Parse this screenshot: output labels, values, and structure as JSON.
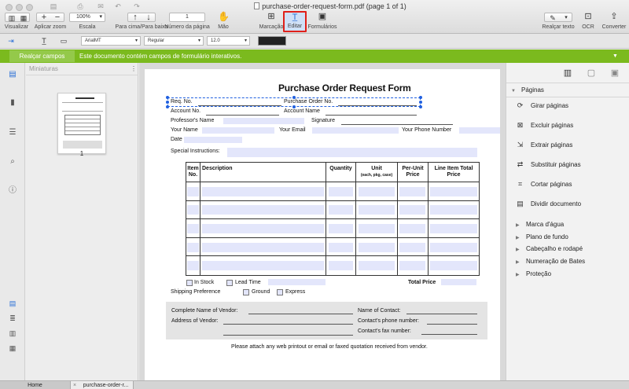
{
  "window": {
    "title": "purchase-order-request-form.pdf (page 1 of 1)"
  },
  "toolbar": {
    "visualizar": "Visualizar",
    "aplicar_zoom": "Aplicar zoom",
    "zoom_value": "100%",
    "escala": "Escala",
    "para_cima_baixo": "Para cima/Para baixo",
    "page_number_value": "1",
    "numero_pagina": "Número da página",
    "mao": "Mão",
    "marcacao": "Marcação",
    "editar": "Editar",
    "formularios": "Formulários",
    "realcar_texto": "Realçar texto",
    "ocr": "OCR",
    "converter": "Converter"
  },
  "format_bar": {
    "font": "ArialMT",
    "style": "Regular",
    "size": "12.0",
    "color": "#222222"
  },
  "banner": {
    "button": "Realçar campos",
    "message": "Este documento contém campos de formulário interativos."
  },
  "thumbnails": {
    "header": "Miniaturas",
    "page_label": "1"
  },
  "form": {
    "title": "Purchase Order Request Form",
    "req_no": "Req. No.",
    "po_no": "Purchase Order No.",
    "account_no": "Account No.",
    "account_name": "Account Name",
    "professor": "Professor's Name",
    "signature": "Signature",
    "your_name": "Your Name",
    "your_email": "Your Email",
    "your_phone": "Your Phone Number",
    "date": "Date",
    "special": "Special Instructions:",
    "columns": {
      "item_no": [
        "Item",
        "No."
      ],
      "description": "Description",
      "quantity": "Quantity",
      "unit": [
        "Unit",
        "(each, pkg, case)"
      ],
      "per_unit_price": [
        "Per-Unit",
        "Price"
      ],
      "line_total": [
        "Line Item Total",
        "Price"
      ]
    },
    "in_stock": "In Stock",
    "lead_time": "Lead Time",
    "total_price": "Total Price",
    "shipping_pref": "Shipping Preference",
    "ground": "Ground",
    "express": "Express",
    "vendor_name": "Complete Name of Vendor:",
    "vendor_address": "Address of Vendor:",
    "contact_name": "Name of Contact:",
    "contact_phone": "Contact's phone number:",
    "contact_fax": "Contact's fax number:",
    "footer": "Please attach any web printout or email or faxed quotation received from vendor."
  },
  "right_panel": {
    "section": "Páginas",
    "items": [
      "Girar páginas",
      "Excluir páginas",
      "Extrair páginas",
      "Substituir páginas",
      "Cortar páginas",
      "Dividir documento"
    ],
    "subsections": [
      "Marca d'água",
      "Plano de fundo",
      "Cabeçalho e rodapé",
      "Numeração de Bates",
      "Proteção"
    ]
  },
  "tabs": {
    "home": "Home",
    "doc": "purchase-order-r..."
  },
  "colors": {
    "accent_green": "#7bba1e",
    "field_fill": "#e3e6fb",
    "highlight_red": "#e0201a"
  }
}
